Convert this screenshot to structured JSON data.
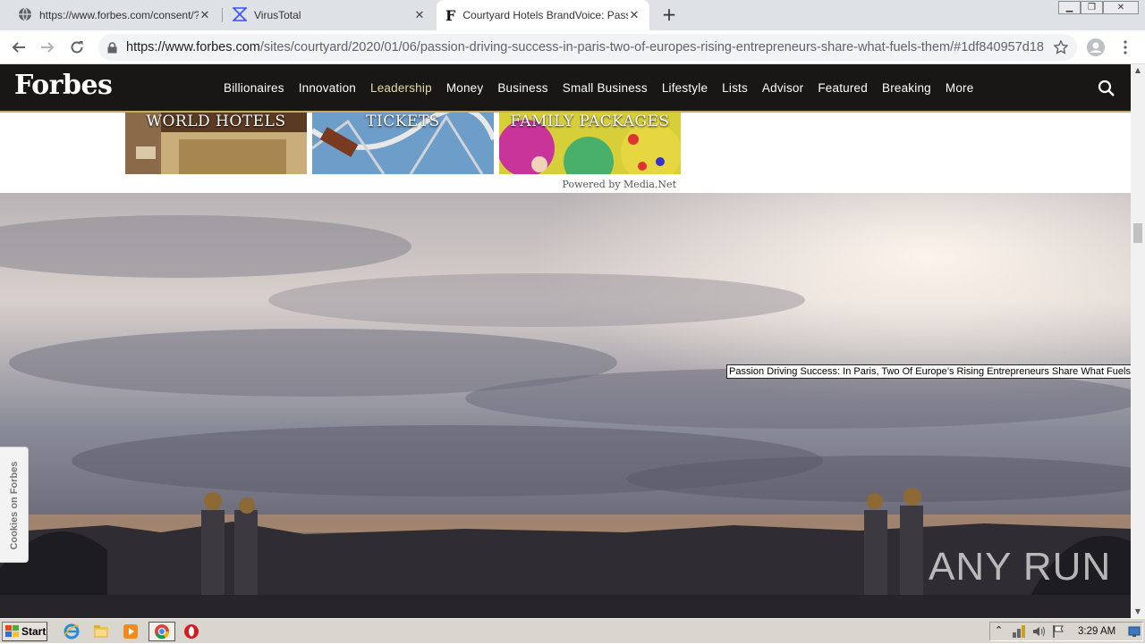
{
  "browser": {
    "tabs": [
      {
        "title": "https://www.forbes.com/consent/?t",
        "icon": "globe-icon",
        "active": false
      },
      {
        "title": "VirusTotal",
        "icon": "virustotal-icon",
        "active": false
      },
      {
        "title": "Courtyard Hotels BrandVoice: Passio",
        "icon": "forbes-f-icon",
        "active": true
      }
    ],
    "new_tab_label": "+",
    "url_host": "https://www.forbes.com",
    "url_path": "/sites/courtyard/2020/01/06/passion-driving-success-in-paris-two-of-europes-rising-entrepreneurs-share-what-fuels-them/#1df840957d18"
  },
  "forbes": {
    "logo": "Forbes",
    "nav": [
      "Billionaires",
      "Innovation",
      "Leadership",
      "Money",
      "Business",
      "Small Business",
      "Lifestyle",
      "Lists",
      "Advisor",
      "Featured",
      "Breaking",
      "More"
    ],
    "active_nav": "Leadership",
    "accent_color": "#c4a962"
  },
  "ads": {
    "tiles": [
      "WORLD HOTELS",
      "TICKETS",
      "FAMILY PACKAGES"
    ],
    "powered_by": "Powered by Media.Net"
  },
  "hero": {
    "tooltip": "Passion Driving Success: In Paris, Two Of Europe’s Rising Entrepreneurs Share What Fuels Them",
    "watermark": "ANY RUN"
  },
  "cookies_tab": "Cookies on Forbes",
  "taskbar": {
    "start_label": "Start",
    "clock": "3:29 AM"
  }
}
